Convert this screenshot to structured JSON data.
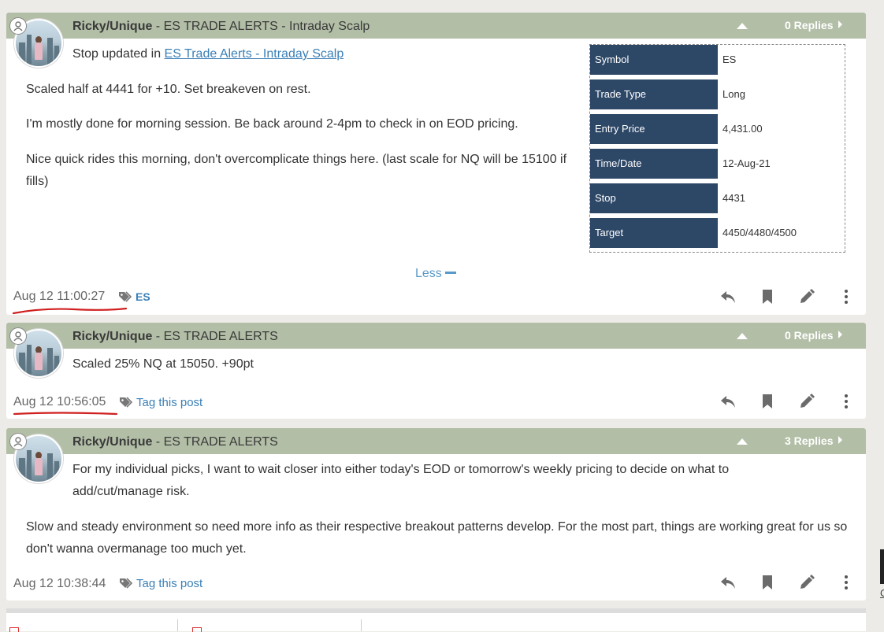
{
  "posts": [
    {
      "author": "Ricky/Unique",
      "channel": " - ES TRADE ALERTS - Intraday Scalp",
      "replies": "0 Replies",
      "intro_prefix": "Stop updated in ",
      "intro_link": "ES Trade Alerts - Intraday Scalp",
      "paragraphs": [
        "Scaled half at 4441 for +10. Set breakeven on rest.",
        "I'm mostly done for morning session. Be back around 2-4pm to check in on EOD pricing.",
        "Nice quick rides this morning, don't overcomplicate things here. (last scale for NQ will be 15100 if fills)"
      ],
      "trade_table": [
        {
          "key": "Symbol",
          "value": "ES"
        },
        {
          "key": "Trade Type",
          "value": "Long"
        },
        {
          "key": "Entry Price",
          "value": "4,431.00"
        },
        {
          "key": "Time/Date",
          "value": "12-Aug-21"
        },
        {
          "key": "Stop",
          "value": "4431"
        },
        {
          "key": "Target",
          "value": "4450/4480/4500"
        }
      ],
      "less_label": "Less",
      "timestamp": "Aug 12 11:00:27",
      "tag": "ES"
    },
    {
      "author": "Ricky/Unique",
      "channel": " - ES TRADE ALERTS",
      "replies": "0 Replies",
      "paragraphs": [
        "Scaled 25% NQ at 15050. +90pt"
      ],
      "timestamp": "Aug 12 10:56:05",
      "tag": "Tag this post"
    },
    {
      "author": "Ricky/Unique",
      "channel": " - ES TRADE ALERTS",
      "replies": "3 Replies",
      "paragraphs": [
        "For my individual picks, I want to wait closer into either today's EOD or tomorrow's weekly pricing to decide on what to add/cut/manage risk.",
        "Slow and steady environment so need more info as their respective breakout patterns develop. For the most part, things are working great for us so don't wanna overmanage too much yet."
      ],
      "timestamp": "Aug 12 10:38:44",
      "tag": "Tag this post"
    }
  ],
  "right_edge_text": "C",
  "icons": [
    "reply-icon",
    "bookmark-icon",
    "edit-icon",
    "more-vertical-icon",
    "tag-icon",
    "user-icon",
    "chevron-up-icon"
  ],
  "colors": {
    "header": "#b2bea6",
    "table_key": "#2d4767",
    "link": "#3a7fb6",
    "annotation": "#d02020"
  }
}
